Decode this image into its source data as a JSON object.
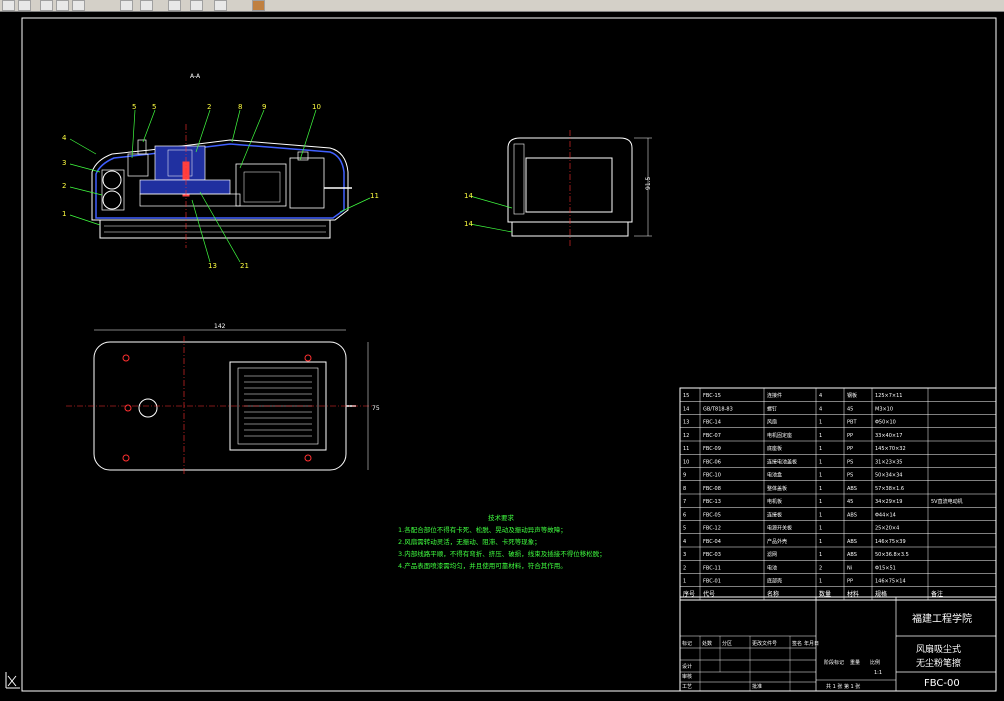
{
  "app": {
    "title": "CAD drawing viewer"
  },
  "section_label": "A-A",
  "callouts": {
    "c1": "1",
    "c2": "2",
    "c3": "3",
    "c4": "4",
    "c5a": "5",
    "c5b": "5",
    "c2top": "2",
    "c8": "8",
    "c9": "9",
    "c10": "10",
    "c11": "11",
    "c13": "13",
    "c21": "21",
    "c14a": "14",
    "c14b": "14"
  },
  "dims": {
    "width": "142",
    "height": "75",
    "side_height": "91.5"
  },
  "notes": {
    "title": "技术要求",
    "lines": [
      "1.各配合部位不得有卡死、松脱、晃动及振动异声等故障；",
      "2.风扇需转动灵活，无振动、阻滞、卡死等现象；",
      "3.内部线路平顺，不得有弯折、挤压、破损，线束及插接不得位移松脱；",
      "4.产品表面喷漆需均匀，并且使用可靠材料，符合其作用。"
    ]
  },
  "bom": {
    "headers": [
      "序号",
      "代号",
      "名称",
      "数量",
      "材料",
      "规格",
      "备注"
    ],
    "rows": [
      [
        "15",
        "FBC-15",
        "连接件",
        "4",
        "钢板",
        "125×7×11",
        ""
      ],
      [
        "14",
        "GB/T818-83",
        "螺钉",
        "4",
        "45",
        "M3×10",
        ""
      ],
      [
        "13",
        "FBC-14",
        "风扇",
        "1",
        "PBT",
        "Φ50×10",
        ""
      ],
      [
        "12",
        "FBC-07",
        "电机固定座",
        "1",
        "PP",
        "33×40×17",
        ""
      ],
      [
        "11",
        "FBC-09",
        "底座板",
        "1",
        "PP",
        "145×70×32",
        ""
      ],
      [
        "10",
        "FBC-06",
        "连接电池盖板",
        "1",
        "PS",
        "31×23×35",
        ""
      ],
      [
        "9",
        "FBC-10",
        "电池盒",
        "1",
        "PS",
        "50×34×34",
        ""
      ],
      [
        "8",
        "FBC-08",
        "整体盖板",
        "1",
        "ABS",
        "57×38×1.6",
        ""
      ],
      [
        "7",
        "FBC-13",
        "电机板",
        "1",
        "45",
        "34×29×19",
        "5V直流电动机"
      ],
      [
        "6",
        "FBC-05",
        "连接板",
        "1",
        "ABS",
        "Φ44×14",
        ""
      ],
      [
        "5",
        "FBC-12",
        "电源开关板",
        "1",
        "",
        "25×20×4",
        ""
      ],
      [
        "4",
        "FBC-04",
        "产品外壳",
        "1",
        "ABS",
        "146×75×39",
        ""
      ],
      [
        "3",
        "FBC-03",
        "滤网",
        "1",
        "ABS",
        "50×36.8×3.5",
        ""
      ],
      [
        "2",
        "FBC-11",
        "电池",
        "2",
        "Ni",
        "Φ15×51",
        ""
      ],
      [
        "1",
        "FBC-01",
        "底部壳",
        "1",
        "PP",
        "146×75×14",
        ""
      ]
    ]
  },
  "title_block": {
    "school": "福建工程学院",
    "product_line1": "风扇吸尘式",
    "product_line2": "无尘粉笔擦",
    "drawing_code": "FBC-00",
    "scale": "1:1",
    "row_labels": [
      "标记",
      "处数",
      "分区",
      "更改文件号",
      "签名",
      "年月日"
    ],
    "design": "设计",
    "review": "审核",
    "process": "工艺",
    "approve": "批准",
    "stage": "阶段标记",
    "weight": "重量",
    "ratio": "比例",
    "sheets": "共 1 张 第 1 张"
  }
}
